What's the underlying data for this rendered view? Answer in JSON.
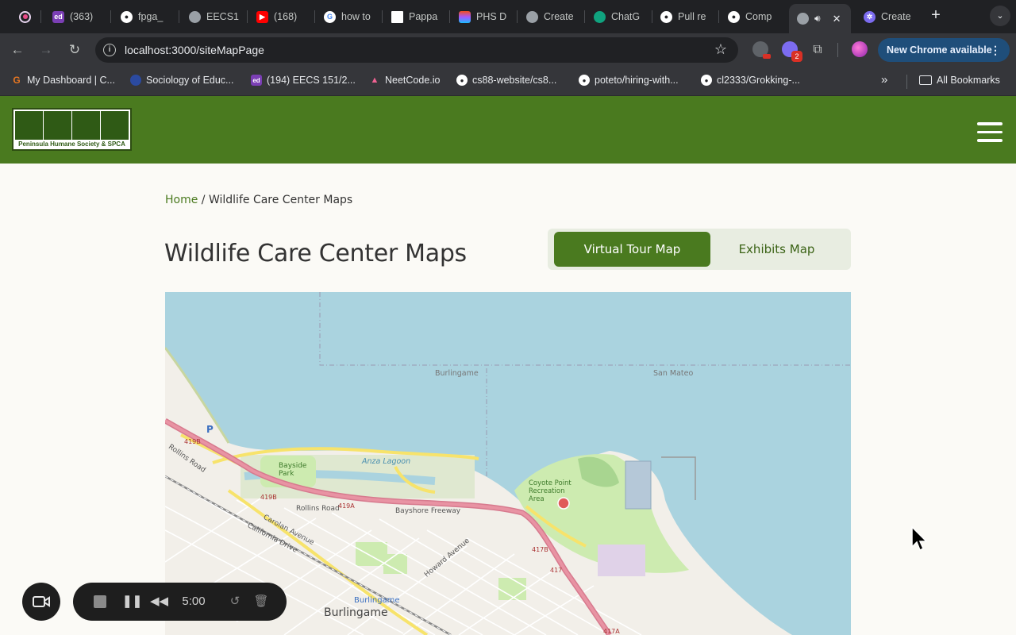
{
  "browser": {
    "tabs": [
      {
        "label": "",
        "favicon": "record-icon",
        "color": "#e8d5f0"
      },
      {
        "label": "(363)",
        "favicon": "ed-icon",
        "color": "#7b3fb5"
      },
      {
        "label": "fpga_",
        "favicon": "github-icon",
        "color": "#ffffff"
      },
      {
        "label": "EECS1",
        "favicon": "globe-icon",
        "color": "#9aa0a6"
      },
      {
        "label": "(168)",
        "favicon": "youtube-icon",
        "color": "#ff0000"
      },
      {
        "label": "how to",
        "favicon": "google-icon",
        "color": "#4285f4"
      },
      {
        "label": "Pappa",
        "favicon": "doc-icon",
        "color": "#ffffff"
      },
      {
        "label": "PHS D",
        "favicon": "figma-icon",
        "color": "#f24e1e"
      },
      {
        "label": "Create",
        "favicon": "globe-icon",
        "color": "#9aa0a6"
      },
      {
        "label": "ChatG",
        "favicon": "chatgpt-icon",
        "color": "#10a37f"
      },
      {
        "label": "Pull re",
        "favicon": "github-icon",
        "color": "#ffffff"
      },
      {
        "label": "Comp",
        "favicon": "github-icon",
        "color": "#ffffff"
      },
      {
        "label": "",
        "favicon": "globe-icon",
        "color": "#9aa0a6"
      },
      {
        "label": "Create",
        "favicon": "gear-icon",
        "color": "#7c6cf0"
      }
    ],
    "url": "localhost:3000/siteMapPage",
    "update_button": "New Chrome available",
    "extension_badge": "2",
    "bookmarks": [
      {
        "label": "My Dashboard | C...",
        "favicon": "canvas-icon",
        "color": "#e87722"
      },
      {
        "label": "Sociology of Educ...",
        "favicon": "circle-icon",
        "color": "#2b4aa0"
      },
      {
        "label": "(194) EECS 151/2...",
        "favicon": "ed-icon",
        "color": "#7b3fb5"
      },
      {
        "label": "NeetCode.io",
        "favicon": "rocket-icon",
        "color": "#f06292"
      },
      {
        "label": "cs88-website/cs8...",
        "favicon": "github-icon",
        "color": "#ffffff"
      },
      {
        "label": "poteto/hiring-with...",
        "favicon": "github-icon",
        "color": "#ffffff"
      },
      {
        "label": "cl2333/Grokking-...",
        "favicon": "github-icon",
        "color": "#ffffff"
      }
    ],
    "all_bookmarks": "All Bookmarks"
  },
  "site": {
    "logo_text": "Peninsula Humane Society & SPCA",
    "brand_color": "#4a7a1f",
    "breadcrumb_home": "Home",
    "breadcrumb_sep": " / ",
    "breadcrumb_current": "Wildlife Care Center Maps",
    "title": "Wildlife Care Center Maps",
    "toggle": {
      "active": "Virtual Tour Map",
      "inactive": "Exhibits Map"
    }
  },
  "map": {
    "labels": {
      "burlingame_north": "Burlingame",
      "san_mateo": "San Mateo",
      "anza_lagoon": "Anza Lagoon",
      "bayside_park": "Bayside Park",
      "coyote_point": "Coyote Point Recreation Area",
      "bayshore_freeway": "Bayshore Freeway",
      "rollins_road": "Rollins Road",
      "rollins_road_2": "Rollins Road",
      "carolan_avenue": "Carolan Avenue",
      "california_drive": "California Drive",
      "howard_avenue": "Howard Avenue",
      "burlingame_station": "Burlingame",
      "burlingame_city": "Burlingame",
      "route_419b": "419B",
      "route_419a": "419A",
      "route_419b_2": "419B",
      "route_417b": "417B",
      "route_417": "417",
      "route_417a": "417A",
      "park_marker": "P"
    }
  },
  "recorder": {
    "time": "5:00"
  }
}
